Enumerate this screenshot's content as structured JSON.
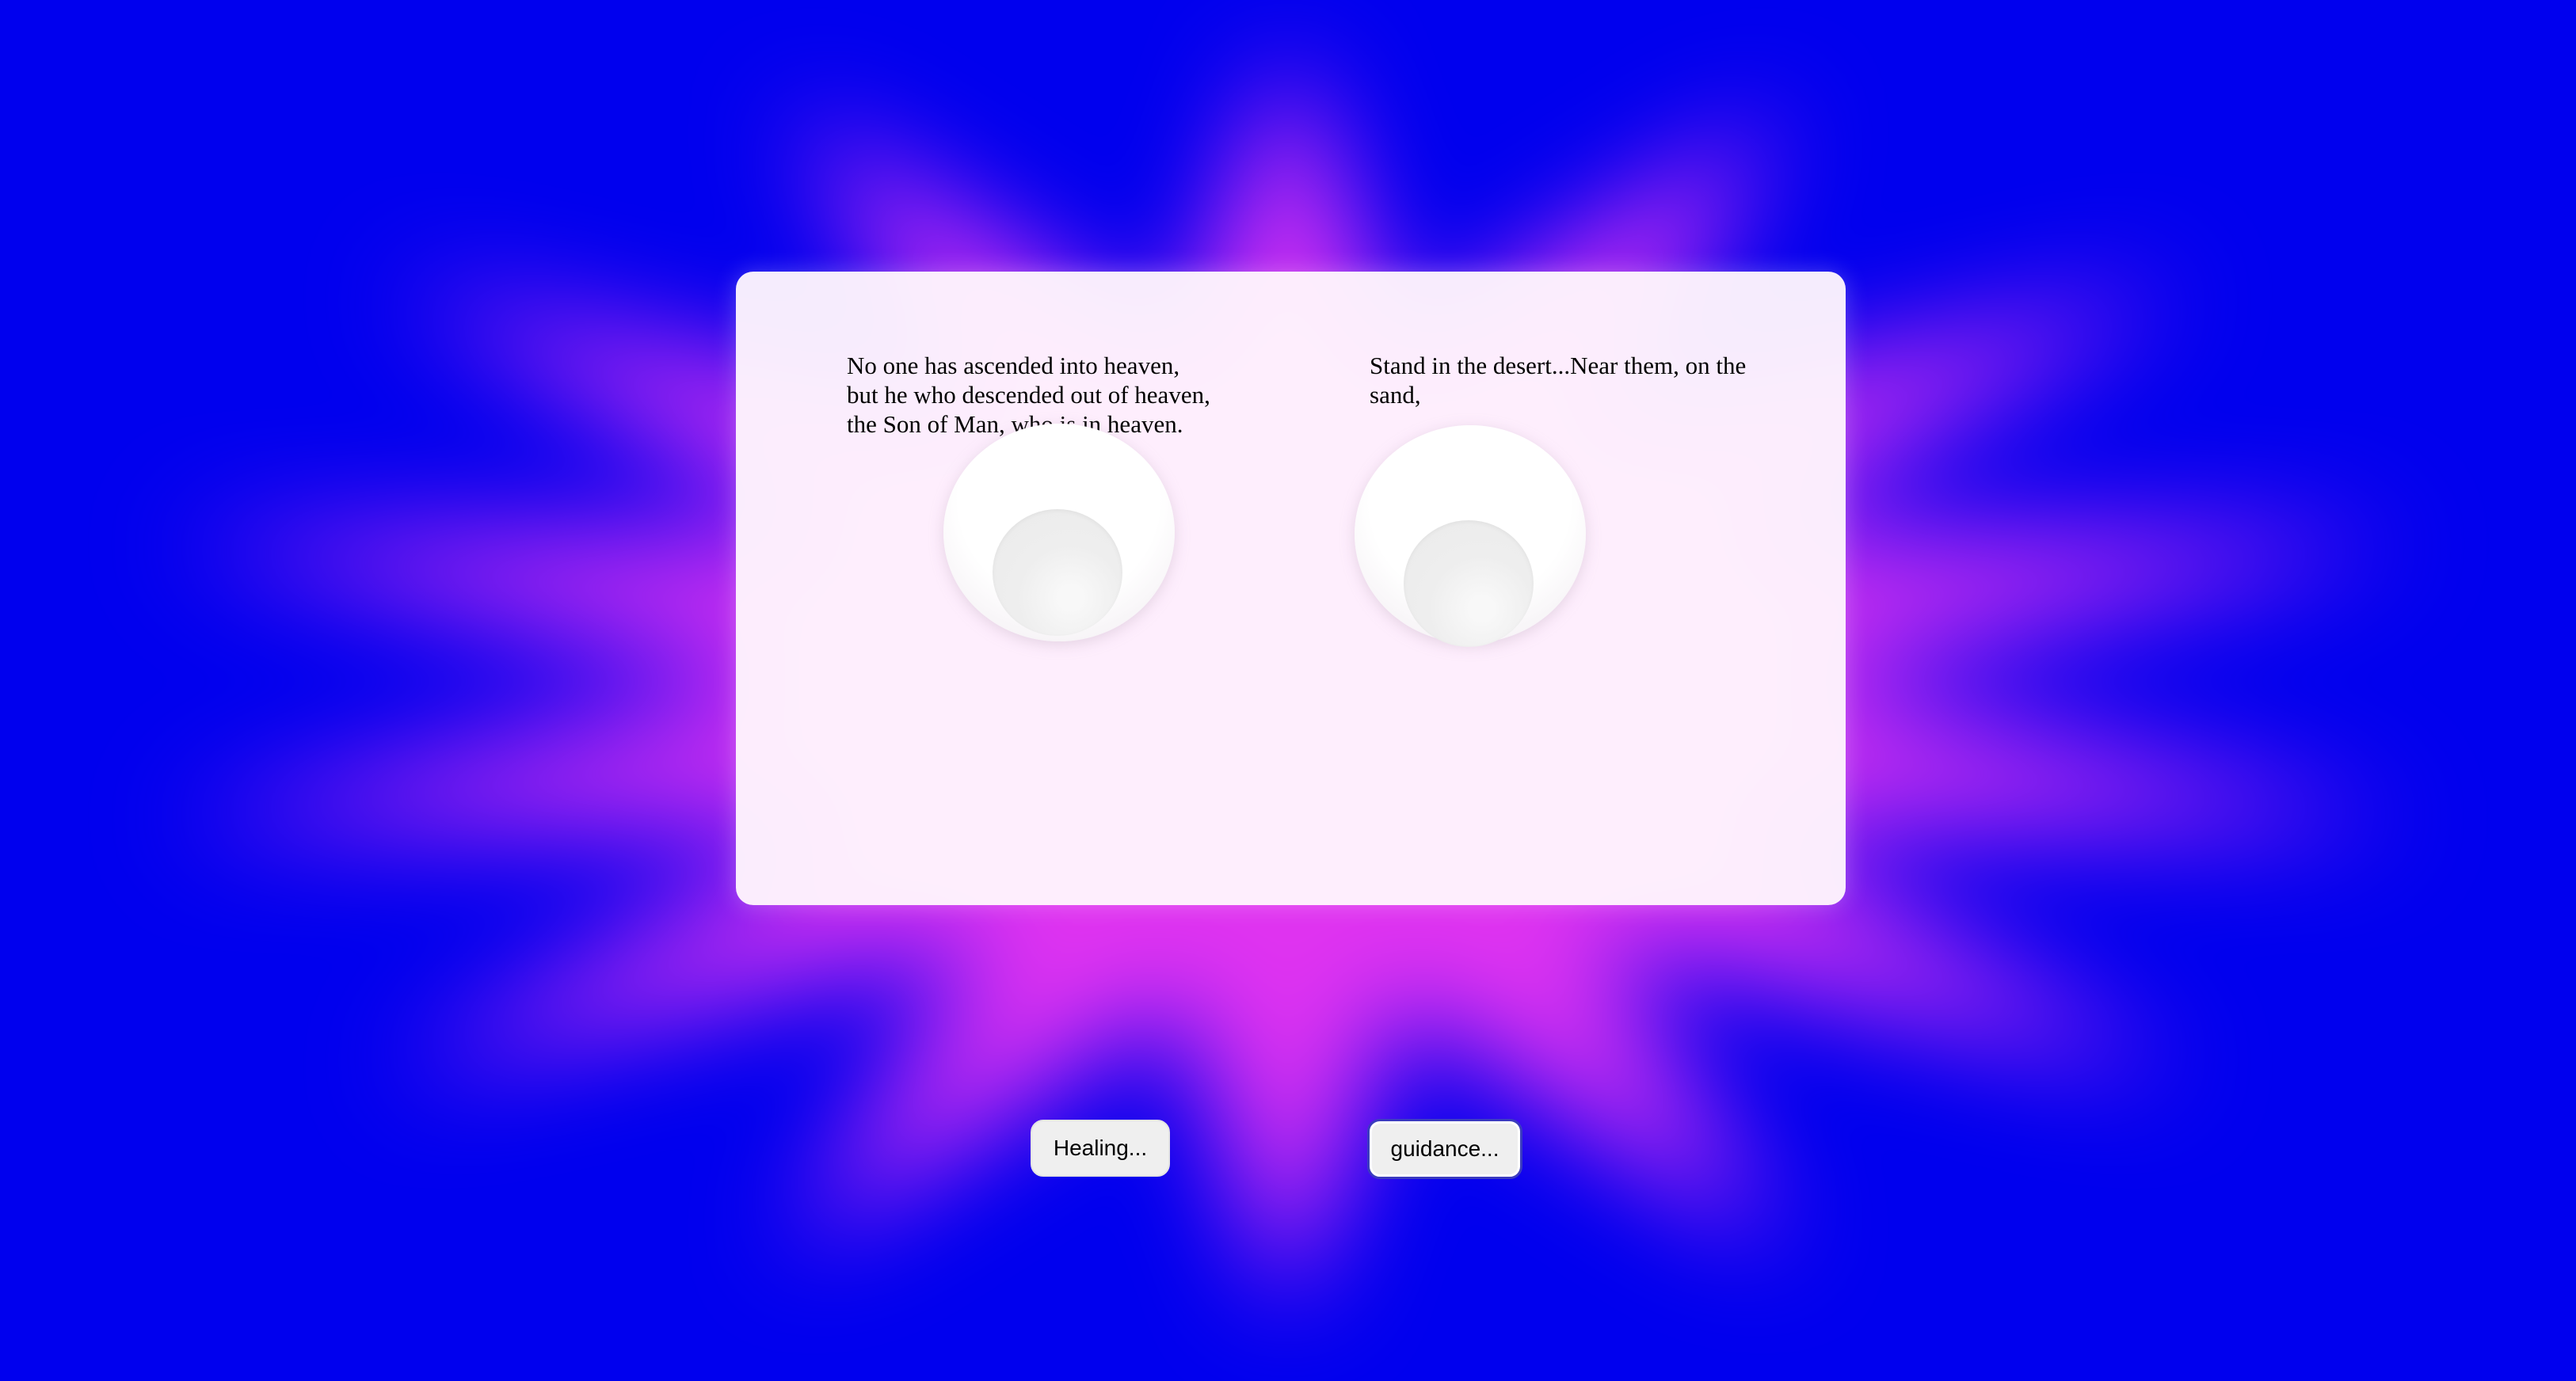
{
  "background": {
    "base_color": "#0000ee",
    "glow_color": "#e033f0"
  },
  "panel": {
    "left_verse": "No one has ascended into heaven, but he who descended out of heaven, the Son of Man, who is in heaven.",
    "right_verse": "Stand in the desert...Near them, on the sand,"
  },
  "buttons": {
    "healing_label": "Healing...",
    "guidance_label": "guidance..."
  }
}
